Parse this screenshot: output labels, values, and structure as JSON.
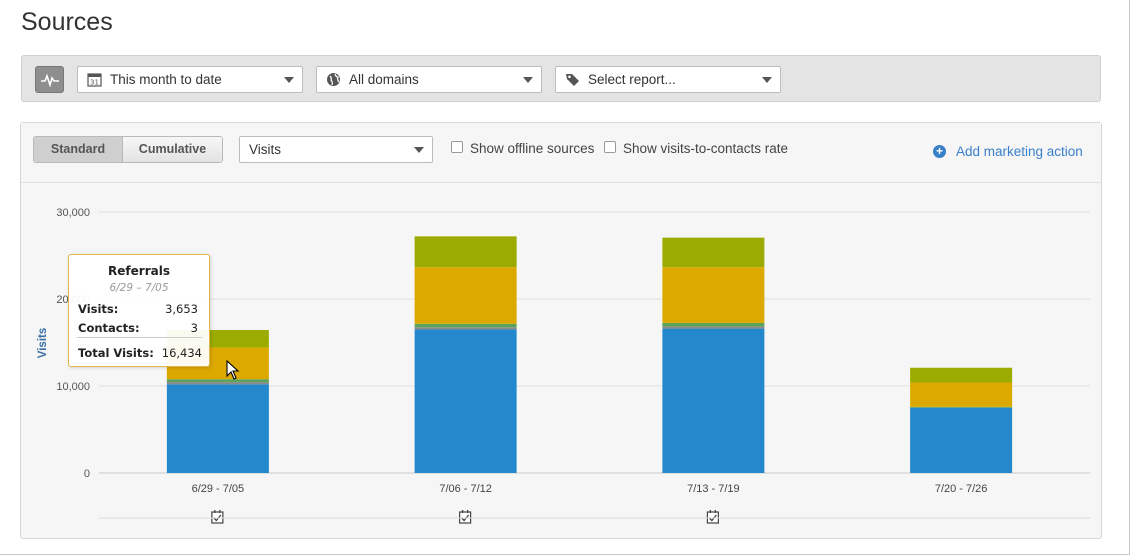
{
  "page": {
    "title": "Sources"
  },
  "toolbar": {
    "date_range": "This month to date",
    "domain": "All domains",
    "report": "Select report..."
  },
  "panel": {
    "view_standard": "Standard",
    "view_cumulative": "Cumulative",
    "metric": "Visits",
    "show_offline": "Show offline sources",
    "show_rate": "Show visits-to-contacts rate",
    "add_action": "Add marketing action"
  },
  "colors": {
    "blue": "#2388cc",
    "gray": "#8a8a8a",
    "green": "#5ba35b",
    "yellow": "#dca900",
    "olive": "#9bab00"
  },
  "tooltip": {
    "title": "Referrals",
    "subtitle": "6/29 – 7/05",
    "visits_label": "Visits:",
    "visits_value": "3,653",
    "contacts_label": "Contacts:",
    "contacts_value": "3",
    "total_label": "Total Visits:",
    "total_value": "16,434"
  },
  "chart_data": {
    "type": "bar",
    "stacked": true,
    "ylabel": "Visits",
    "yticks": [
      "0",
      "10,000",
      "20,000",
      "30,000"
    ],
    "ylim": [
      0,
      30000
    ],
    "categories": [
      "6/29 - 7/05",
      "7/06 - 7/12",
      "7/13 - 7/19",
      "7/20 - 7/26"
    ],
    "series": [
      {
        "color": "#2388cc",
        "values": [
          10200,
          16500,
          16600,
          7500
        ]
      },
      {
        "color": "#8a8a8a",
        "values": [
          250,
          250,
          250,
          0
        ]
      },
      {
        "color": "#5ba35b",
        "values": [
          331,
          400,
          400,
          100
        ]
      },
      {
        "color": "#dca900",
        "values": [
          3653,
          6500,
          6400,
          2800
        ]
      },
      {
        "color": "#9bab00",
        "values": [
          2000,
          3550,
          3400,
          1700
        ]
      }
    ],
    "events": [
      true,
      true,
      true,
      false
    ]
  }
}
